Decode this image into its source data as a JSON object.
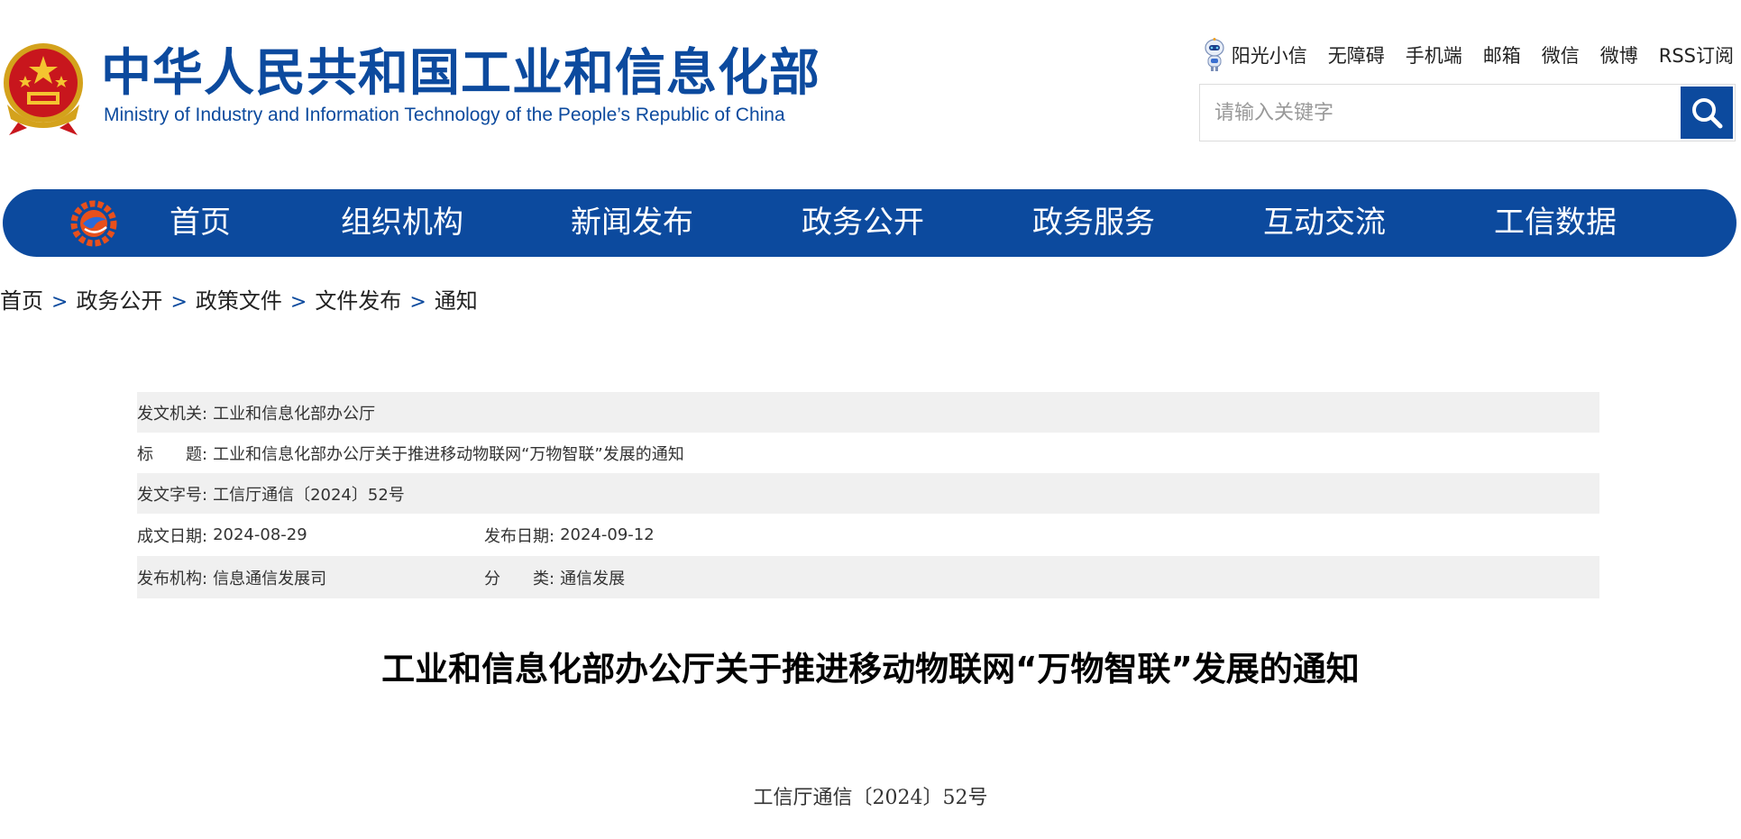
{
  "header": {
    "site_title": "中华人民共和国工业和信息化部",
    "site_subtitle": "Ministry of Industry and Information Technology of the People’s Republic of China",
    "emblem_icon": "national-emblem-icon",
    "top_links": [
      "阳光小信",
      "无障碍",
      "手机端",
      "邮箱",
      "微信",
      "微博",
      "RSS订阅"
    ],
    "search": {
      "placeholder": "请输入关键字",
      "icon": "search-icon"
    }
  },
  "nav": {
    "logo_icon": "miit-logo-icon",
    "items": [
      "首页",
      "组织机构",
      "新闻发布",
      "政务公开",
      "政务服务",
      "互动交流",
      "工信数据"
    ]
  },
  "breadcrumb": [
    "首页",
    "政务公开",
    "政策文件",
    "文件发布",
    "通知"
  ],
  "info": {
    "issuer_label": "发文机关:",
    "issuer": "工业和信息化部办公厅",
    "title_label": "标　　题:",
    "title": "工业和信息化部办公厅关于推进移动物联网“万物智联”发展的通知",
    "doc_no_label": "发文字号:",
    "doc_no": "工信厅通信〔2024〕52号",
    "written_date_label": "成文日期:",
    "written_date": "2024-08-29",
    "publish_date_label": "发布日期:",
    "publish_date": "2024-09-12",
    "agency_label": "发布机构:",
    "agency": "信息通信发展司",
    "category_label": "分　　类:",
    "category": "通信发展"
  },
  "article": {
    "title": "工业和信息化部办公厅关于推进移动物联网“万物智联”发展的通知",
    "doc_number": "工信厅通信〔2024〕52号"
  },
  "colors": {
    "brand_blue": "#0c4a9e",
    "row_shade": "#f0f0f0"
  }
}
